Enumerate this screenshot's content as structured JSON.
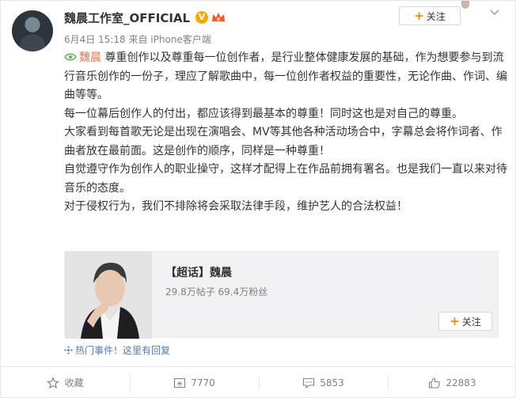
{
  "user": {
    "name": "魏晨工作室_OFFICIAL",
    "verified_mark": "V",
    "meta": "6月4日 15:18 来自 iPhone客户端"
  },
  "header": {
    "follow_label": "关注"
  },
  "post": {
    "mention": "魏晨",
    "line1_rest": " 尊重创作以及尊重每一位创作者，是行业整体健康发展的基础，作为想要参与到流行音乐创作的一份子，理应了解歌曲中，每一位创作者权益的重要性，无论作曲、作词、编曲等等。",
    "para2": "每一位幕后创作人的付出，都应该得到最基本的尊重！同时这也是对自己的尊重。",
    "para3": "大家看到每首歌无论是出现在演唱会、MV等其他各种活动场合中，字幕总会将作词者、作曲者放在最前面。这是创作的顺序，同样是一种尊重！",
    "para4": "自觉遵守作为创作人的职业操守，这样才配得上在作品前拥有署名。也是我们一直以来对待音乐的态度。",
    "para5": "对于侵权行为，我们不排除将会采取法律手段，维护艺人的合法权益！"
  },
  "link_card": {
    "title": "【超话】魏晨",
    "stats": "29.8万帖子 69.4万粉丝",
    "follow_label": "关注"
  },
  "hot_event": {
    "text": "热门事件！这里有回复"
  },
  "actions": {
    "favorite": "收藏",
    "repost": "7770",
    "comment": "5853",
    "like": "22883"
  },
  "colors": {
    "accent": "#ff8200",
    "mention": "#eb7350",
    "link": "#507daf",
    "verified": "#ffa500"
  }
}
